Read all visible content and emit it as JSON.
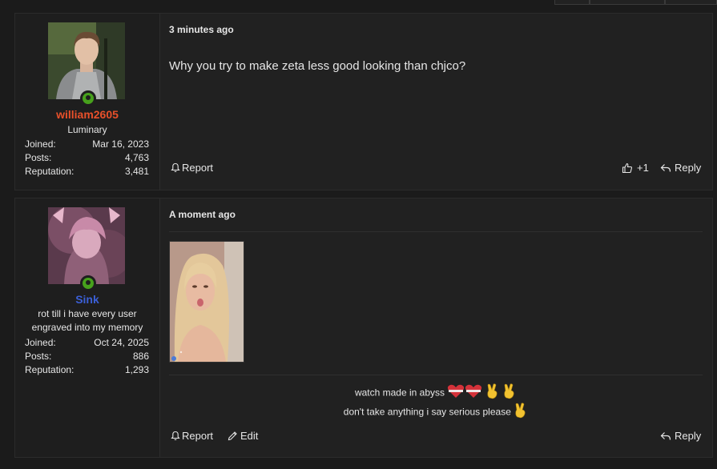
{
  "posts": [
    {
      "user": {
        "name": "william2605",
        "title": "Luminary",
        "name_color": "#e8502a"
      },
      "stats": [
        {
          "label": "Joined:",
          "value": "Mar 16, 2023"
        },
        {
          "label": "Posts:",
          "value": "4,763"
        },
        {
          "label": "Reputation:",
          "value": "3,481"
        }
      ],
      "time": "3 minutes ago",
      "message": "Why you try to make zeta less good looking than chjco?",
      "actions": {
        "report": "Report",
        "like": "+1",
        "reply": "Reply"
      }
    },
    {
      "user": {
        "name": "Sink",
        "title_line1": "rot till i have every user",
        "title_line2": "engraved into my memory",
        "name_color": "#3b5fd6"
      },
      "stats": [
        {
          "label": "Joined:",
          "value": "Oct 24, 2025"
        },
        {
          "label": "Posts:",
          "value": "886"
        },
        {
          "label": "Reputation:",
          "value": "1,293"
        }
      ],
      "time": "A moment ago",
      "signature": {
        "line1": "watch made in abyss",
        "line2": "don't take anything i say serious please"
      },
      "actions": {
        "report": "Report",
        "edit": "Edit",
        "reply": "Reply"
      }
    }
  ],
  "colors": {
    "background": "#1b1b1b",
    "panel": "#212121",
    "online": "#47a11c"
  }
}
